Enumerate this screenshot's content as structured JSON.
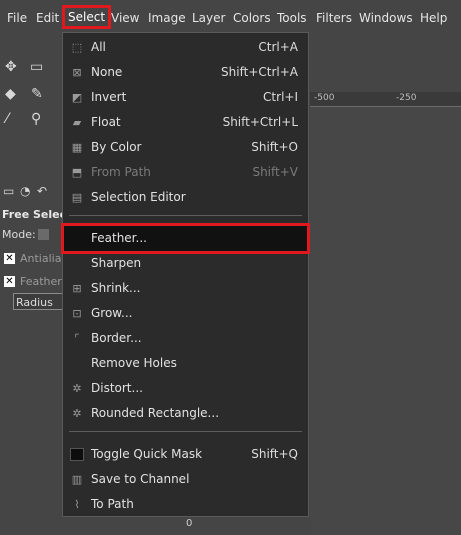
{
  "menubar": {
    "items": [
      "File",
      "Edit",
      "Select",
      "View",
      "Image",
      "Layer",
      "Colors",
      "Tools",
      "Filters",
      "Windows",
      "Help"
    ],
    "active": "Select"
  },
  "tool_options": {
    "title": "Free Select",
    "mode_label": "Mode:",
    "antialias_label": "Antialias",
    "feather_label": "Feather",
    "radius_value": "Radius"
  },
  "ruler": {
    "labels": [
      "-500",
      "-250"
    ]
  },
  "canvas": {
    "bottom_label": "0"
  },
  "select_menu": {
    "items": [
      {
        "label": "All",
        "shortcut": "Ctrl+A",
        "icon": "select-all-icon",
        "enabled": true
      },
      {
        "label": "None",
        "shortcut": "Shift+Ctrl+A",
        "icon": "select-none-icon",
        "enabled": true
      },
      {
        "label": "Invert",
        "shortcut": "Ctrl+I",
        "icon": "invert-icon",
        "enabled": true
      },
      {
        "label": "Float",
        "shortcut": "Shift+Ctrl+L",
        "icon": "float-icon",
        "enabled": true
      },
      {
        "label": "By Color",
        "shortcut": "Shift+O",
        "icon": "by-color-icon",
        "enabled": true
      },
      {
        "label": "From Path",
        "shortcut": "Shift+V",
        "icon": "from-path-icon",
        "enabled": false
      },
      {
        "label": "Selection Editor",
        "shortcut": "",
        "icon": "selection-editor-icon",
        "enabled": true
      },
      {
        "label": "Feather...",
        "shortcut": "",
        "icon": "",
        "enabled": true,
        "highlighted": true
      },
      {
        "label": "Sharpen",
        "shortcut": "",
        "icon": "",
        "enabled": true
      },
      {
        "label": "Shrink...",
        "shortcut": "",
        "icon": "shrink-icon",
        "enabled": true
      },
      {
        "label": "Grow...",
        "shortcut": "",
        "icon": "grow-icon",
        "enabled": true
      },
      {
        "label": "Border...",
        "shortcut": "",
        "icon": "border-icon",
        "enabled": true
      },
      {
        "label": "Remove Holes",
        "shortcut": "",
        "icon": "",
        "enabled": true
      },
      {
        "label": "Distort...",
        "shortcut": "",
        "icon": "distort-icon",
        "enabled": true
      },
      {
        "label": "Rounded Rectangle...",
        "shortcut": "",
        "icon": "rounded-rectangle-icon",
        "enabled": true
      },
      {
        "label": "Toggle Quick Mask",
        "shortcut": "Shift+Q",
        "icon": "quick-mask-icon",
        "enabled": true
      },
      {
        "label": "Save to Channel",
        "shortcut": "",
        "icon": "save-channel-icon",
        "enabled": true
      },
      {
        "label": "To Path",
        "shortcut": "",
        "icon": "to-path-icon",
        "enabled": true
      }
    ]
  }
}
